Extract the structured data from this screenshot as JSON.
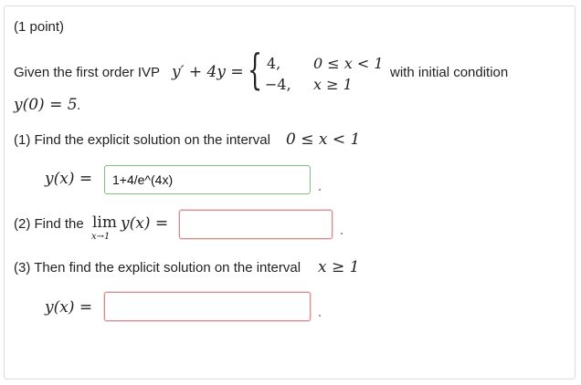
{
  "problem": {
    "points_label": "(1 point)",
    "intro_text": "Given the first order IVP",
    "ode_lhs": "y′ + 4y =",
    "case1_value": "4,",
    "case1_condition": "0 ≤ x < 1",
    "case2_value": "−4,",
    "case2_condition": "x ≥ 1",
    "initial_text": "with initial condition",
    "initial_condition": "y(0) = 5",
    "initial_period": "."
  },
  "part1": {
    "prompt": "(1) Find the explicit solution on the interval",
    "interval": "0 ≤ x < 1",
    "lhs": "y(x) =",
    "answer_value": "1+4/e^(4x)",
    "status": "correct"
  },
  "part2": {
    "prompt": "(2) Find the",
    "lim_word": "lim",
    "lim_sub": "x→1",
    "lim_expr": "y(x) =",
    "answer_value": "",
    "status": "empty"
  },
  "part3": {
    "prompt": "(3) Then find the explicit solution on the interval",
    "interval": "x ≥ 1",
    "lhs": "y(x) =",
    "answer_value": "",
    "status": "empty"
  },
  "colors": {
    "correct_border": "#7fbf7f",
    "empty_border": "#d98a8a",
    "card_border": "#dcdcdc"
  }
}
